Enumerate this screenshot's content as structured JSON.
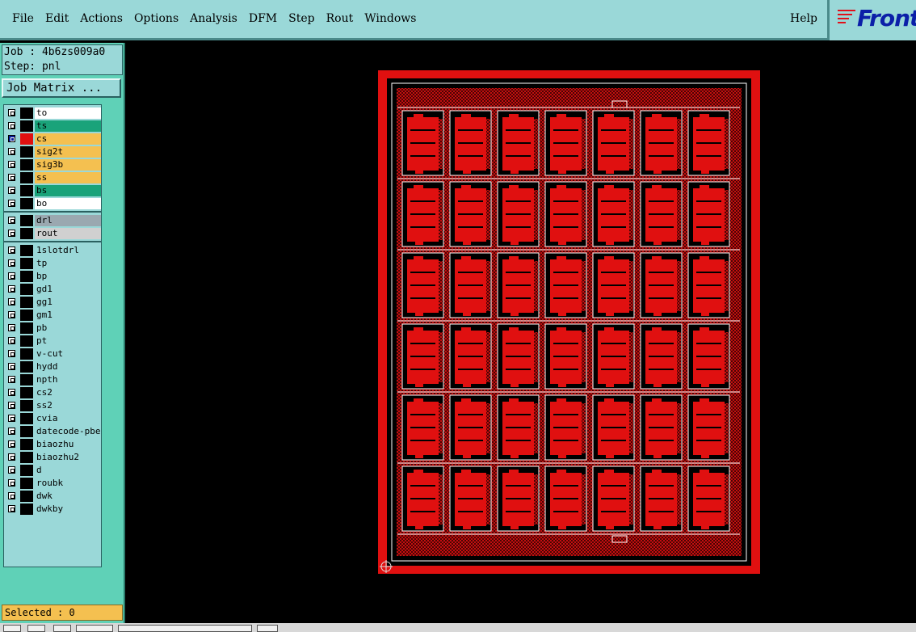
{
  "menu": {
    "items": [
      "File",
      "Edit",
      "Actions",
      "Options",
      "Analysis",
      "DFM",
      "Step",
      "Rout",
      "Windows"
    ],
    "help": "Help"
  },
  "logo": {
    "text": "Front"
  },
  "job": {
    "job_line": "Job : 4b6zs009a0",
    "step_line": "Step: pnl"
  },
  "job_matrix_label": "Job Matrix ...",
  "layers": {
    "board": [
      {
        "name": "to",
        "color": "#ffffff",
        "active": false
      },
      {
        "name": "ts",
        "color": "#1aa37a",
        "active": false
      },
      {
        "name": "cs",
        "color": "#f4c050",
        "active": true
      },
      {
        "name": "sig2t",
        "color": "#f4c050",
        "active": false
      },
      {
        "name": "sig3b",
        "color": "#f4c050",
        "active": false
      },
      {
        "name": "ss",
        "color": "#f4c050",
        "active": false
      },
      {
        "name": "bs",
        "color": "#1aa37a",
        "active": false
      },
      {
        "name": "bo",
        "color": "#ffffff",
        "active": false
      }
    ],
    "drill": [
      {
        "name": "drl",
        "color": "#9aa8b0"
      },
      {
        "name": "rout",
        "color": "#d0d0d0"
      }
    ],
    "misc": [
      "1slotdrl",
      "tp",
      "bp",
      "gd1",
      "gg1",
      "gm1",
      "pb",
      "pt",
      "v-cut",
      "hydd",
      "npth",
      "cs2",
      "ss2",
      "cvia",
      "datecode-pbe",
      "biaozhu",
      "biaozhu2",
      "d",
      "roubk",
      "dwk",
      "dwkby"
    ]
  },
  "selected_text": "Selected : 0",
  "colors": {
    "menubar": "#9ad8d8",
    "panel": "#5fd1b7",
    "board_red": "#e01010",
    "canvas": "#000000"
  }
}
